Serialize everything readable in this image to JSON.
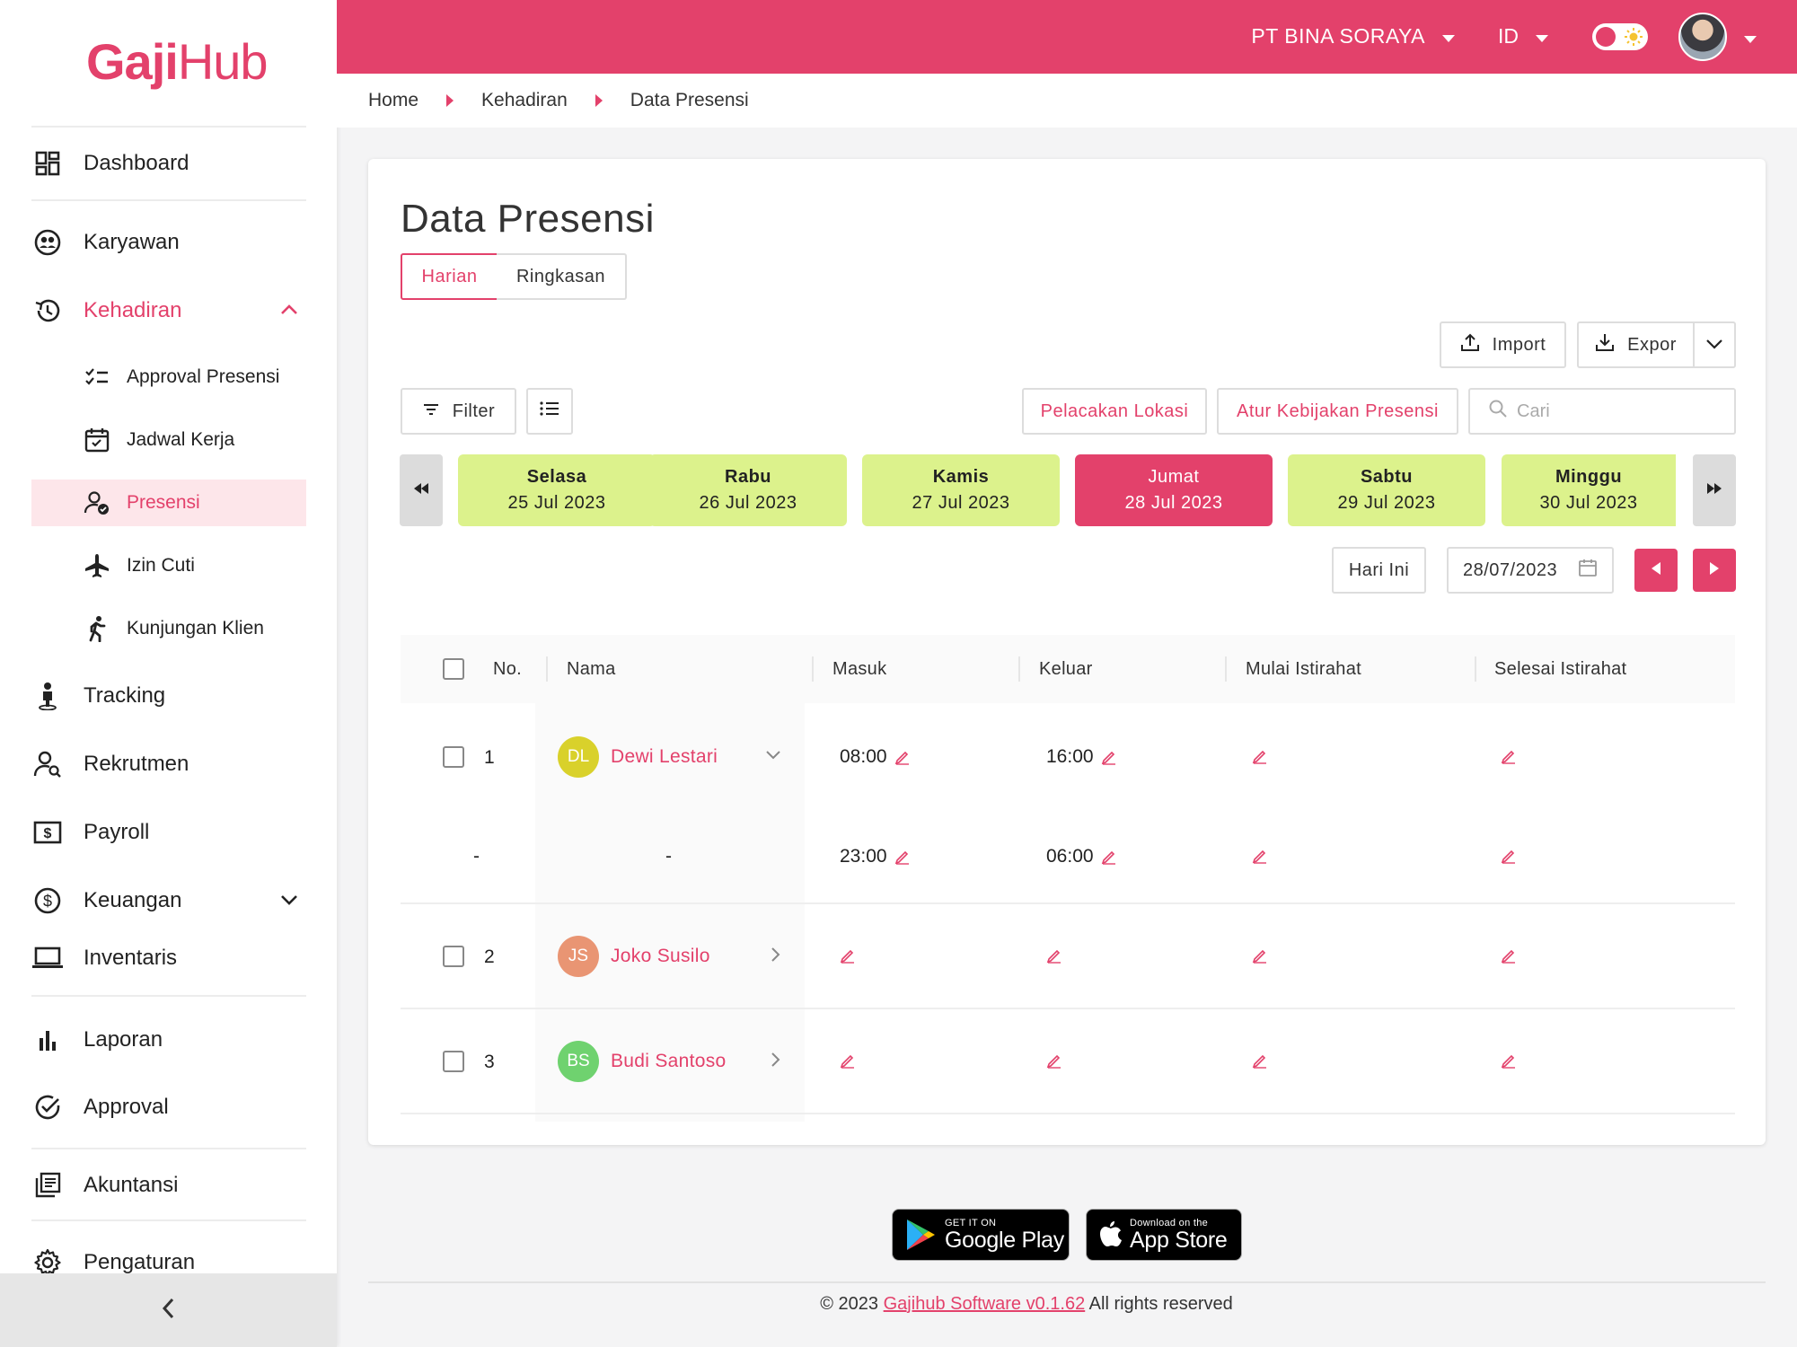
{
  "app": {
    "logo_text_a": "Gaji",
    "logo_text_b": "Hub",
    "brand_color": "#e3416b"
  },
  "topbar": {
    "company": "PT BINA SORAYA",
    "language": "ID"
  },
  "sidebar": {
    "items": [
      {
        "label": "Dashboard",
        "icon": "dashboard-icon"
      },
      {
        "label": "Karyawan",
        "icon": "employee-icon"
      },
      {
        "label": "Kehadiran",
        "icon": "history-icon",
        "expanded": true
      },
      {
        "label": "Tracking",
        "icon": "person-pin-icon"
      },
      {
        "label": "Rekrutmen",
        "icon": "recruit-icon"
      },
      {
        "label": "Payroll",
        "icon": "payroll-icon"
      },
      {
        "label": "Keuangan",
        "icon": "dollar-icon",
        "expanded": false
      },
      {
        "label": "Inventaris",
        "icon": "laptop-icon"
      },
      {
        "label": "Laporan",
        "icon": "bar-chart-icon"
      },
      {
        "label": "Approval",
        "icon": "check-circle-icon"
      },
      {
        "label": "Akuntansi",
        "icon": "ledger-icon"
      },
      {
        "label": "Pengaturan",
        "icon": "gear-icon"
      }
    ],
    "sub_items": [
      {
        "label": "Approval Presensi",
        "icon": "checklist-icon"
      },
      {
        "label": "Jadwal Kerja",
        "icon": "calendar-check-icon"
      },
      {
        "label": "Presensi",
        "icon": "person-check-icon",
        "active": true
      },
      {
        "label": "Izin Cuti",
        "icon": "airplane-icon"
      },
      {
        "label": "Kunjungan Klien",
        "icon": "walking-icon"
      }
    ]
  },
  "breadcrumb": [
    "Home",
    "Kehadiran",
    "Data Presensi"
  ],
  "page": {
    "title": "Data Presensi",
    "tabs": [
      {
        "label": "Harian",
        "active": true
      },
      {
        "label": "Ringkasan",
        "active": false
      }
    ],
    "import_label": "Import",
    "export_label": "Expor",
    "filter_label": "Filter",
    "location_label": "Pelacakan Lokasi",
    "policy_label": "Atur Kebijakan Presensi",
    "search_placeholder": "Cari",
    "today_label": "Hari Ini",
    "date_value": "28/07/2023"
  },
  "days": [
    {
      "name": "Selasa",
      "date": "25 Jul 2023",
      "selected": false
    },
    {
      "name": "Rabu",
      "date": "26 Jul 2023",
      "selected": false
    },
    {
      "name": "Kamis",
      "date": "27 Jul 2023",
      "selected": false
    },
    {
      "name": "Jumat",
      "date": "28 Jul 2023",
      "selected": true
    },
    {
      "name": "Sabtu",
      "date": "29 Jul 2023",
      "selected": false
    },
    {
      "name": "Minggu",
      "date": "30 Jul 2023",
      "selected": false
    }
  ],
  "table": {
    "columns": [
      "No.",
      "Nama",
      "Masuk",
      "Keluar",
      "Mulai Istirahat",
      "Selesai Istirahat"
    ],
    "rows": [
      {
        "no": "1",
        "initials": "DL",
        "name": "Dewi Lestari",
        "avatar_color": "#d9d12b",
        "expanded": true,
        "shifts": [
          {
            "masuk": "08:00",
            "keluar": "16:00"
          },
          {
            "no": "-",
            "name": "-",
            "masuk": "23:00",
            "keluar": "06:00"
          }
        ]
      },
      {
        "no": "2",
        "initials": "JS",
        "name": "Joko Susilo",
        "avatar_color": "#e99573",
        "expanded": false
      },
      {
        "no": "3",
        "initials": "BS",
        "name": "Budi Santoso",
        "avatar_color": "#6fd26f",
        "expanded": false
      }
    ]
  },
  "footer": {
    "google_small": "GET IT ON",
    "google_big": "Google Play",
    "apple_small": "Download on the",
    "apple_big": "App Store",
    "copyright_prefix": "© 2023",
    "copyright_link": "Gajihub Software v0.1.62",
    "copyright_suffix": "All rights reserved"
  }
}
